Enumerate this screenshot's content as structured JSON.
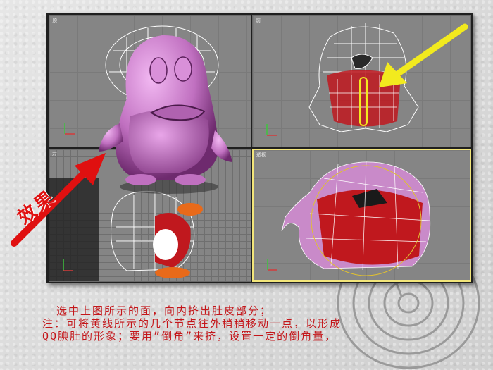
{
  "viewports": {
    "top_label": "顶",
    "front_label": "前",
    "left_label": "左",
    "perspective_label": "透视"
  },
  "annotation": {
    "effect_label": "效果"
  },
  "caption": {
    "line1": "选中上图所示的面，向内挤出肚皮部分；",
    "line2": "注：可将黄线所示的几个节点往外稍稍移动一点，以形成",
    "line3": "QQ腆肚的形象；要用”倒角”来挤，设置一定的倒角量，"
  },
  "colors": {
    "caption_text": "#c4161a",
    "active_viewport_border": "#f3e67a",
    "arrow_red": "#e01010",
    "arrow_yellow": "#f2ea1e",
    "penguin_pink": "#c070c0",
    "belly_red": "#c0181e"
  },
  "icons": {
    "effect_arrow": "red-arrow-icon",
    "vertex_arrow": "yellow-arrow-icon",
    "axis_gizmo": "axis-gizmo-icon"
  }
}
